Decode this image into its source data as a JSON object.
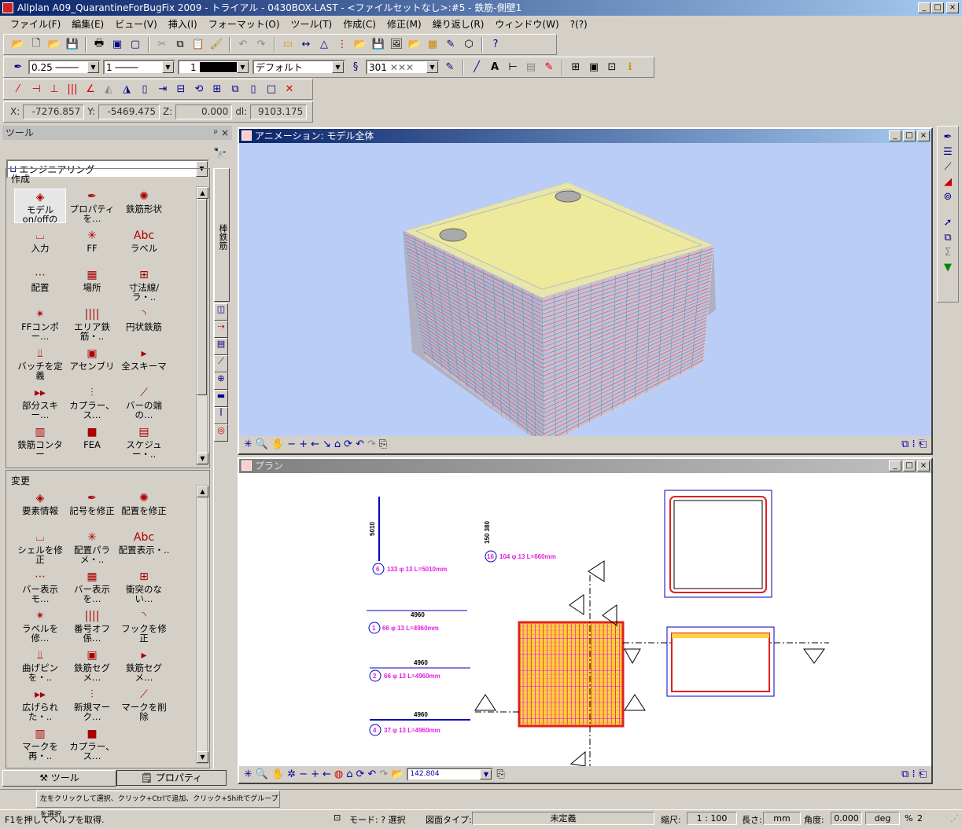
{
  "window": {
    "title": "Allplan A09_QuarantineForBugFix 2009 - トライアル - 0430BOX-LAST - <ファイルセットなし>:#5 - 鉄筋-側壁1",
    "min": "_",
    "max": "□",
    "close": "×"
  },
  "menu": [
    "ファイル(F)",
    "編集(E)",
    "ビュー(V)",
    "挿入(I)",
    "フォーマット(O)",
    "ツール(T)",
    "作成(C)",
    "修正(M)",
    "繰り返し(R)",
    "ウィンドウ(W)",
    "?(?)"
  ],
  "format_bar": {
    "pen": "0.25 ────",
    "line": "1 ────",
    "color": "1",
    "layer": "デフォルト",
    "pattern": "301"
  },
  "coords": {
    "x_label": "X:",
    "x": "-7276.857",
    "y_label": "Y:",
    "y": "-5469.475",
    "z_label": "Z:",
    "z": "0.000",
    "dl_label": "dl:",
    "dl": "9103.175"
  },
  "tools_panel": {
    "title": "ツール",
    "pin": "ᵖ",
    "close": "×",
    "module": "エンジニアリング",
    "vertical_tab": "棒鉄筋",
    "create": {
      "heading": "作成",
      "items": [
        "モデル on/offの鉄…",
        "プロパティを…",
        "鉄筋形状",
        "入力",
        "FF",
        "ラベル",
        "配置",
        "場所",
        "寸法線/ラ・..",
        "FFコンポー…",
        "エリア鉄筋・..",
        "円状鉄筋",
        "バッチを定義",
        "アセンブリ",
        "全スキーマ",
        "部分スキー…",
        "カプラー、ス…",
        "バーの端の…",
        "鉄筋コンター",
        "FEA",
        "スケジュー・.."
      ]
    },
    "modify": {
      "heading": "変更",
      "items": [
        "要素情報",
        "記号を修正",
        "配置を修正",
        "シェルを修正",
        "配置パラメ・..",
        "配置表示・..",
        "バー表示モ…",
        "バー表示を…",
        "衝突のない…",
        "ラベルを修…",
        "番号オフ係…",
        "フックを修正",
        "曲げピンを・..",
        "鉄筋セグメ…",
        "鉄筋セグメ…",
        "広げられた・..",
        "新規マーク…",
        "マークを削除",
        "マークを再・..",
        "カプラー、ス…"
      ]
    },
    "tabs": [
      "ツール",
      "プロパティ"
    ]
  },
  "anim_window": {
    "title": "アニメーション: モデル全体",
    "bg": "#b9cdf7"
  },
  "plan_window": {
    "title": "プラン",
    "zoom": "142.804",
    "labels": [
      {
        "dim": "5010",
        "mark": "6",
        "text": "133 φ 13  L=5010mm"
      },
      {
        "dim": "150 380",
        "mark": "16",
        "text": "104 φ 13  L=660mm"
      },
      {
        "dim": "4960",
        "mark": "1",
        "text": "66 φ 13  L=4960mm"
      },
      {
        "dim": "4960",
        "mark": "2",
        "text": "66 φ 13  L=4960mm"
      },
      {
        "dim": "4960",
        "mark": "4",
        "text": "37 φ 13  L=4960mm"
      }
    ]
  },
  "hint": "左をクリックして選択、クリック+Ctrlで追加、クリック+Shiftでグループを選択",
  "statusbar": {
    "help": "F1を押してヘルプを取得.",
    "mode": "モード: ? 選択",
    "drawing_type_label": "図面タイプ:",
    "drawing_type": "未定義",
    "scale_label": "縮尺:",
    "scale": "1 : 100",
    "length_label": "長さ:",
    "length_unit": "mm",
    "angle_label": "角度:",
    "angle": "0.000",
    "angle_unit": "deg",
    "percent_label": "%",
    "percent": "2"
  },
  "colors": {
    "title_start": "#0a246a",
    "title_end": "#a6caf0",
    "rebar_magenta": "#e020e0",
    "rebar_blue": "#0000c0"
  }
}
